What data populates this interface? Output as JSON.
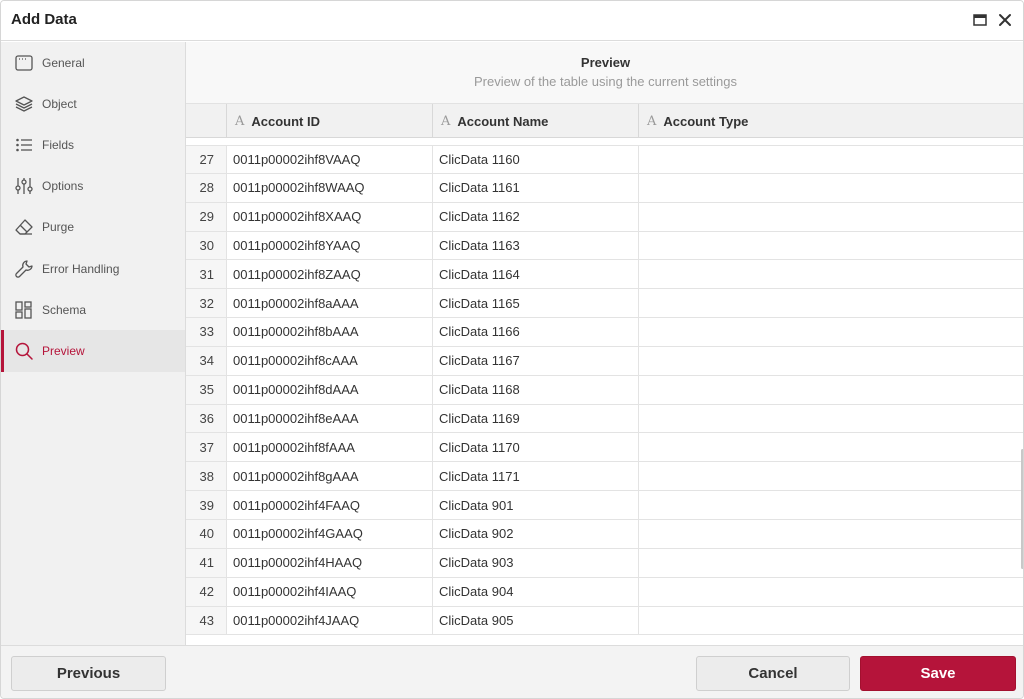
{
  "window": {
    "title": "Add Data"
  },
  "sidebar": {
    "items": [
      {
        "label": "General",
        "icon": "window-icon"
      },
      {
        "label": "Object",
        "icon": "layers-icon"
      },
      {
        "label": "Fields",
        "icon": "list-icon"
      },
      {
        "label": "Options",
        "icon": "sliders-icon"
      },
      {
        "label": "Purge",
        "icon": "eraser-icon"
      },
      {
        "label": "Error Handling",
        "icon": "wrench-icon"
      },
      {
        "label": "Schema",
        "icon": "grid-layout-icon"
      },
      {
        "label": "Preview",
        "icon": "search-icon",
        "active": true
      }
    ]
  },
  "preview": {
    "title": "Preview",
    "subtitle": "Preview of the table using the current settings"
  },
  "table": {
    "columns": [
      {
        "label": "Account ID",
        "type_icon": "A"
      },
      {
        "label": "Account Name",
        "type_icon": "A"
      },
      {
        "label": "Account Type",
        "type_icon": "A"
      }
    ],
    "rows": [
      {
        "n": "27",
        "id": "0011p00002ihf8VAAQ",
        "name": "ClicData 1160",
        "type": ""
      },
      {
        "n": "28",
        "id": "0011p00002ihf8WAAQ",
        "name": "ClicData 1161",
        "type": ""
      },
      {
        "n": "29",
        "id": "0011p00002ihf8XAAQ",
        "name": "ClicData 1162",
        "type": ""
      },
      {
        "n": "30",
        "id": "0011p00002ihf8YAAQ",
        "name": "ClicData 1163",
        "type": ""
      },
      {
        "n": "31",
        "id": "0011p00002ihf8ZAAQ",
        "name": "ClicData 1164",
        "type": ""
      },
      {
        "n": "32",
        "id": "0011p00002ihf8aAAA",
        "name": "ClicData 1165",
        "type": ""
      },
      {
        "n": "33",
        "id": "0011p00002ihf8bAAA",
        "name": "ClicData 1166",
        "type": ""
      },
      {
        "n": "34",
        "id": "0011p00002ihf8cAAA",
        "name": "ClicData 1167",
        "type": ""
      },
      {
        "n": "35",
        "id": "0011p00002ihf8dAAA",
        "name": "ClicData 1168",
        "type": ""
      },
      {
        "n": "36",
        "id": "0011p00002ihf8eAAA",
        "name": "ClicData 1169",
        "type": ""
      },
      {
        "n": "37",
        "id": "0011p00002ihf8fAAA",
        "name": "ClicData 1170",
        "type": ""
      },
      {
        "n": "38",
        "id": "0011p00002ihf8gAAA",
        "name": "ClicData 1171",
        "type": ""
      },
      {
        "n": "39",
        "id": "0011p00002ihf4FAAQ",
        "name": "ClicData 901",
        "type": ""
      },
      {
        "n": "40",
        "id": "0011p00002ihf4GAAQ",
        "name": "ClicData 902",
        "type": ""
      },
      {
        "n": "41",
        "id": "0011p00002ihf4HAAQ",
        "name": "ClicData 903",
        "type": ""
      },
      {
        "n": "42",
        "id": "0011p00002ihf4IAAQ",
        "name": "ClicData 904",
        "type": ""
      },
      {
        "n": "43",
        "id": "0011p00002ihf4JAAQ",
        "name": "ClicData 905",
        "type": ""
      }
    ]
  },
  "footer": {
    "previous_label": "Previous",
    "cancel_label": "Cancel",
    "save_label": "Save"
  },
  "colors": {
    "accent": "#b5143a"
  }
}
